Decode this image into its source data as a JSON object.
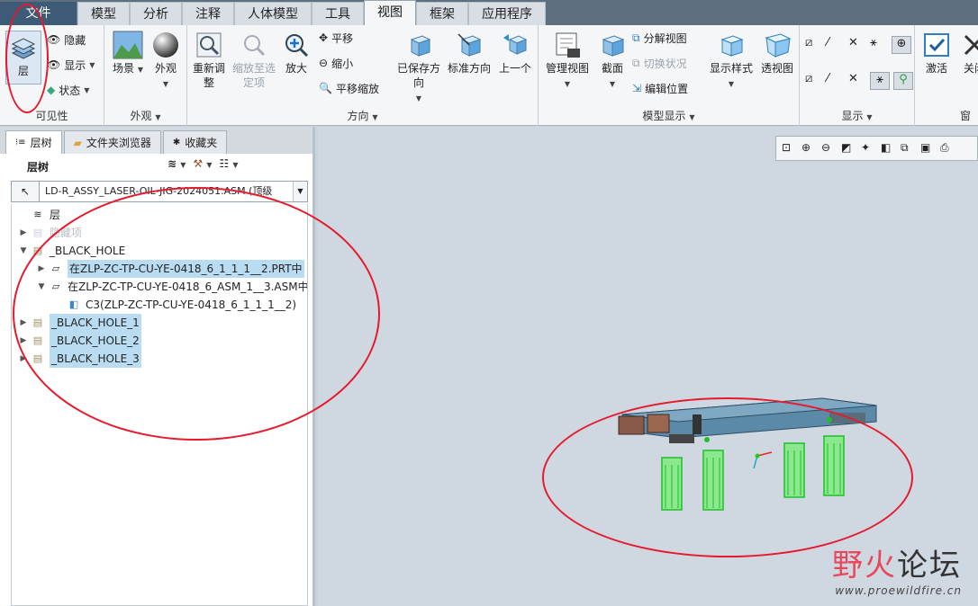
{
  "menu": {
    "tabs": [
      {
        "label": "文件",
        "state": "file"
      },
      {
        "label": "模型",
        "state": "normal"
      },
      {
        "label": "分析",
        "state": "normal"
      },
      {
        "label": "注释",
        "state": "normal"
      },
      {
        "label": "人体模型",
        "state": "normal"
      },
      {
        "label": "工具",
        "state": "normal"
      },
      {
        "label": "视图",
        "state": "active"
      },
      {
        "label": "框架",
        "state": "normal"
      },
      {
        "label": "应用程序",
        "state": "normal"
      }
    ]
  },
  "ribbon": {
    "visibility": {
      "group_label": "可见性",
      "layer": "层",
      "hide": "隐藏",
      "show": "显示",
      "status": "状态"
    },
    "appearance": {
      "group_label": "外观",
      "scene": "场景",
      "appearance": "外观"
    },
    "orientation": {
      "group_label": "方向",
      "refit": "重新调整",
      "zoom_to_selected": "缩放至选定项",
      "zoom_in": "放大",
      "pan": "平移",
      "zoom_out": "缩小",
      "pan_zoom": "平移缩放",
      "saved_orientations": "已保存方向",
      "standard_orientation": "标准方向",
      "previous": "上一个"
    },
    "model_display": {
      "group_label": "模型显示",
      "manage_views": "管理视图",
      "section": "截面",
      "explode_view": "分解视图",
      "toggle_status": "切换状况",
      "edit_position": "编辑位置",
      "display_style": "显示样式",
      "perspective": "透视图"
    },
    "show": {
      "group_label": "显示"
    },
    "window": {
      "group_label": "窗口",
      "activate": "激活",
      "close": "关闭"
    }
  },
  "left_panel": {
    "tabs": [
      {
        "label": "层树",
        "active": true
      },
      {
        "label": "文件夹浏览器",
        "active": false
      },
      {
        "label": "收藏夹",
        "active": false
      }
    ],
    "title": "层树",
    "model_selector": "LD-R_ASSY_LASER-OIL-JIG-2024051.ASM (顶级",
    "tree": [
      {
        "label": "层",
        "indent": 0,
        "twisty": "",
        "selected": false,
        "faded": false
      },
      {
        "label": "隐藏项",
        "indent": 0,
        "twisty": "▶",
        "selected": false,
        "faded": true
      },
      {
        "label": "_BLACK_HOLE",
        "indent": 0,
        "twisty": "▼",
        "selected": false,
        "faded": false
      },
      {
        "label": "在ZLP-ZC-TP-CU-YE-0418_6_1_1_1__2.PRT中",
        "indent": 1,
        "twisty": "▶",
        "selected": true,
        "faded": false
      },
      {
        "label": "在ZLP-ZC-TP-CU-YE-0418_6_ASM_1__3.ASM中",
        "indent": 1,
        "twisty": "▼",
        "selected": false,
        "faded": false
      },
      {
        "label": "C3(ZLP-ZC-TP-CU-YE-0418_6_1_1_1__2)",
        "indent": 2,
        "twisty": "",
        "selected": false,
        "faded": false
      },
      {
        "label": "_BLACK_HOLE_1",
        "indent": 0,
        "twisty": "▶",
        "selected": true,
        "faded": false
      },
      {
        "label": "_BLACK_HOLE_2",
        "indent": 0,
        "twisty": "▶",
        "selected": true,
        "faded": false
      },
      {
        "label": "_BLACK_HOLE_3",
        "indent": 0,
        "twisty": "▶",
        "selected": true,
        "faded": false
      }
    ]
  },
  "watermark": {
    "main_red": "野火",
    "main_dark": "论坛",
    "url": "www.proewildfire.cn"
  },
  "colors": {
    "annotation": "#e6192d",
    "selection": "#b9dcf3",
    "wireframe": "#1fbf2a",
    "model_blue": "#4e7a96"
  }
}
